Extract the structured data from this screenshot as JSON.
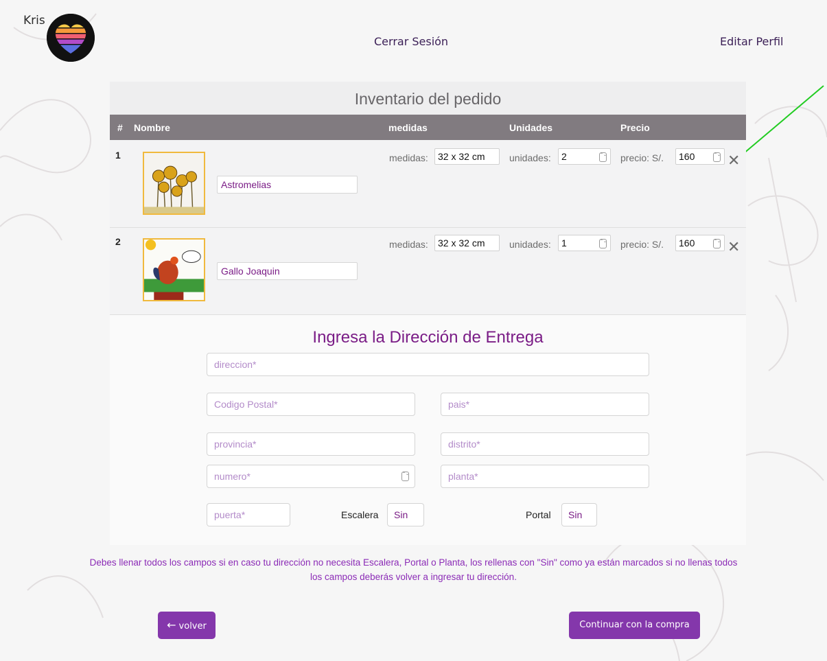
{
  "header": {
    "user_name": "Kris",
    "logout_label": "Cerrar Sesión",
    "edit_profile_label": "Editar Perfil"
  },
  "inventory": {
    "title": "Inventario del pedido",
    "columns": [
      "#",
      "Nombre",
      "medidas",
      "Unidades",
      "Precio"
    ],
    "items": [
      {
        "number": "1",
        "name": "Astromelias",
        "medidas_label": "medidas:",
        "medidas_value": "32 x 32 cm",
        "unidades_label": "unidades:",
        "unidades_value": "2",
        "precio_label": "precio: S/.",
        "precio_value": "160",
        "thumbnail_icon": "flowers-painting-icon"
      },
      {
        "number": "2",
        "name": "Gallo Joaquin",
        "medidas_label": "medidas:",
        "medidas_value": "32 x 32 cm",
        "unidades_label": "unidades:",
        "unidades_value": "1",
        "precio_label": "precio: S/.",
        "precio_value": "160",
        "thumbnail_icon": "rooster-painting-icon"
      }
    ]
  },
  "address": {
    "title": "Ingresa la Dirección de Entrega",
    "direccion_placeholder": "direccion*",
    "codigo_postal_placeholder": "Codigo Postal*",
    "pais_placeholder": "pais*",
    "provincia_placeholder": "provincia*",
    "distrito_placeholder": "distrito*",
    "numero_placeholder": "numero*",
    "planta_placeholder": "planta*",
    "puerta_placeholder": "puerta*",
    "escalera_label": "Escalera",
    "escalera_value": "Sin",
    "portal_label": "Portal",
    "portal_value": "Sin"
  },
  "note_line1": "Debes llenar todos los campos si en caso tu dirección no necesita Escalera, Portal o Planta, los rellenas con \"Sin\" como ya están marcados si no llenas todos",
  "note_line2": "los campos deberás volver a ingresar tu dirección.",
  "buttons": {
    "back_label": "volver",
    "continue_label": "Continuar con la compra"
  },
  "colors": {
    "accent": "#8437ab",
    "title_purple": "#7a1c86",
    "table_header": "#817b80",
    "arrow_annotation": "#22cc22"
  }
}
